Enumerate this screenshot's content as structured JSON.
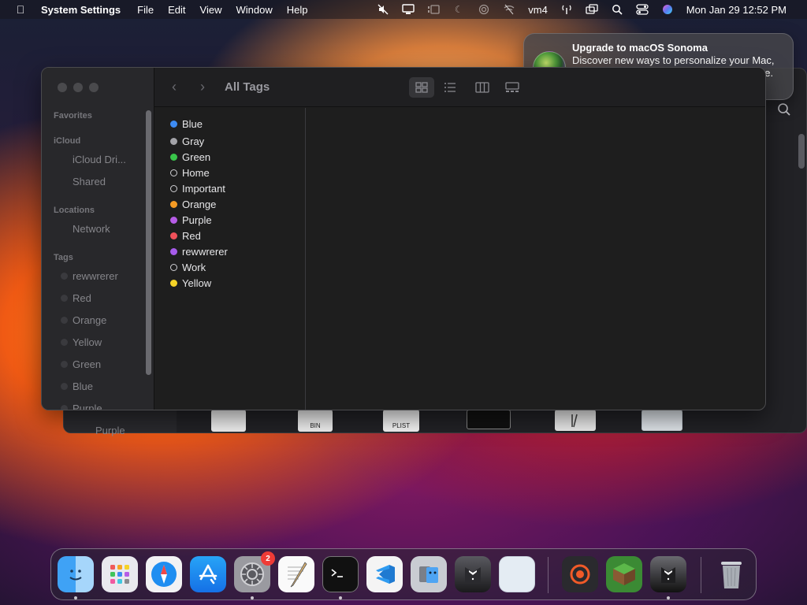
{
  "menubar": {
    "app_name": "System Settings",
    "menus": [
      "File",
      "Edit",
      "View",
      "Window",
      "Help"
    ],
    "user": "vm4",
    "clock": "Mon Jan 29  12:52 PM"
  },
  "notification": {
    "title": "Upgrade to macOS Sonoma",
    "body": "Discover new ways to personalize your Mac, elevate your video calls, and get more done."
  },
  "finder": {
    "title": "All Tags",
    "sidebar": {
      "favorites_heading": "Favorites",
      "icloud_heading": "iCloud",
      "icloud_items": [
        "iCloud Dri...",
        "Shared"
      ],
      "locations_heading": "Locations",
      "locations_items": [
        "Network"
      ],
      "tags_heading": "Tags",
      "tags_items": [
        "rewwrerer",
        "Red",
        "Orange",
        "Yellow",
        "Green",
        "Blue",
        "Purple"
      ]
    },
    "tags": [
      {
        "name": "Blue",
        "color": "#3d8bf2"
      },
      {
        "name": "Gray",
        "color": "#a3a3a8"
      },
      {
        "name": "Green",
        "color": "#39c54a"
      },
      {
        "name": "Home",
        "color": ""
      },
      {
        "name": "Important",
        "color": ""
      },
      {
        "name": "Orange",
        "color": "#f59b24"
      },
      {
        "name": "Purple",
        "color": "#b65ce6"
      },
      {
        "name": "Red",
        "color": "#f0515a"
      },
      {
        "name": "rewwrerer",
        "color": "#a65bea"
      },
      {
        "name": "Work",
        "color": ""
      },
      {
        "name": "Yellow",
        "color": "#f5d327"
      }
    ]
  },
  "back_window": {
    "sidebar_item": "Purple",
    "file_labels": [
      "BIN",
      "PLIST"
    ]
  },
  "dock": {
    "settings_badge": "2"
  }
}
